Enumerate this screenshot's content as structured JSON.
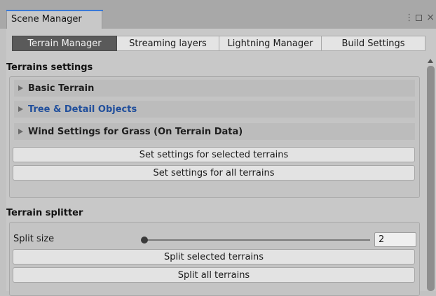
{
  "window": {
    "tab_title": "Scene Manager",
    "controls": {
      "kebab": "⋮",
      "close": "×"
    }
  },
  "toolbar": {
    "tabs": [
      {
        "label": "Terrain Manager",
        "active": true
      },
      {
        "label": "Streaming layers",
        "active": false
      },
      {
        "label": "Lightning Manager",
        "active": false
      },
      {
        "label": "Build Settings",
        "active": false
      }
    ]
  },
  "terrains_settings": {
    "title": "Terrains settings",
    "foldouts": [
      {
        "label": "Basic Terrain"
      },
      {
        "label": "Tree & Detail Objects"
      },
      {
        "label": "Wind Settings for Grass (On Terrain Data)"
      }
    ],
    "buttons": {
      "set_selected": "Set settings for selected terrains",
      "set_all": "Set settings for all terrains"
    }
  },
  "terrain_splitter": {
    "title": "Terrain splitter",
    "split_size_label": "Split size",
    "split_size_value": "2",
    "slider_fraction": 0.0,
    "buttons": {
      "split_selected": "Split selected terrains",
      "split_all": "Split all terrains"
    }
  },
  "colors": {
    "active_tab": "#5a5a5a",
    "accent": "#3a79d6",
    "selected_foldout_text": "#214f9c"
  }
}
